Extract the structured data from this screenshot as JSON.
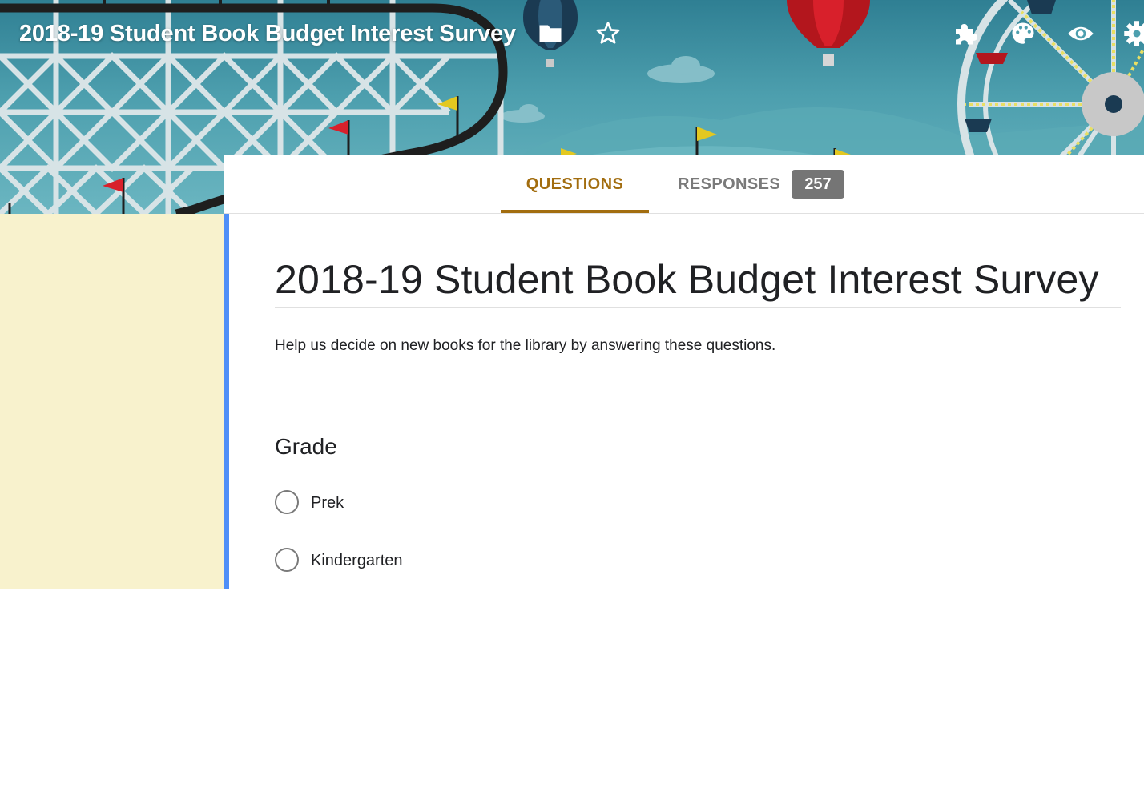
{
  "header": {
    "title": "2018-19 Student Book Budget Interest Survey",
    "icons": [
      "folder-icon",
      "star-icon",
      "addons-icon",
      "palette-icon",
      "preview-eye-icon",
      "settings-gear-icon"
    ]
  },
  "tabs": [
    {
      "label": "QUESTIONS",
      "active": true
    },
    {
      "label": "RESPONSES",
      "active": false,
      "badge": "257"
    }
  ],
  "form": {
    "title": "2018-19 Student Book Budget Interest Survey",
    "description": "Help us decide on new books for the library by answering these questions.",
    "questions": [
      {
        "title": "Grade",
        "type": "multiple-choice",
        "options": [
          "Prek",
          "Kindergarten"
        ]
      }
    ]
  },
  "colors": {
    "accent": "#a26d0f",
    "focus_bar": "#4f8ff7",
    "side_panel": "#f8f2cd",
    "badge": "#757575",
    "header_sky": "#4d9fae"
  }
}
